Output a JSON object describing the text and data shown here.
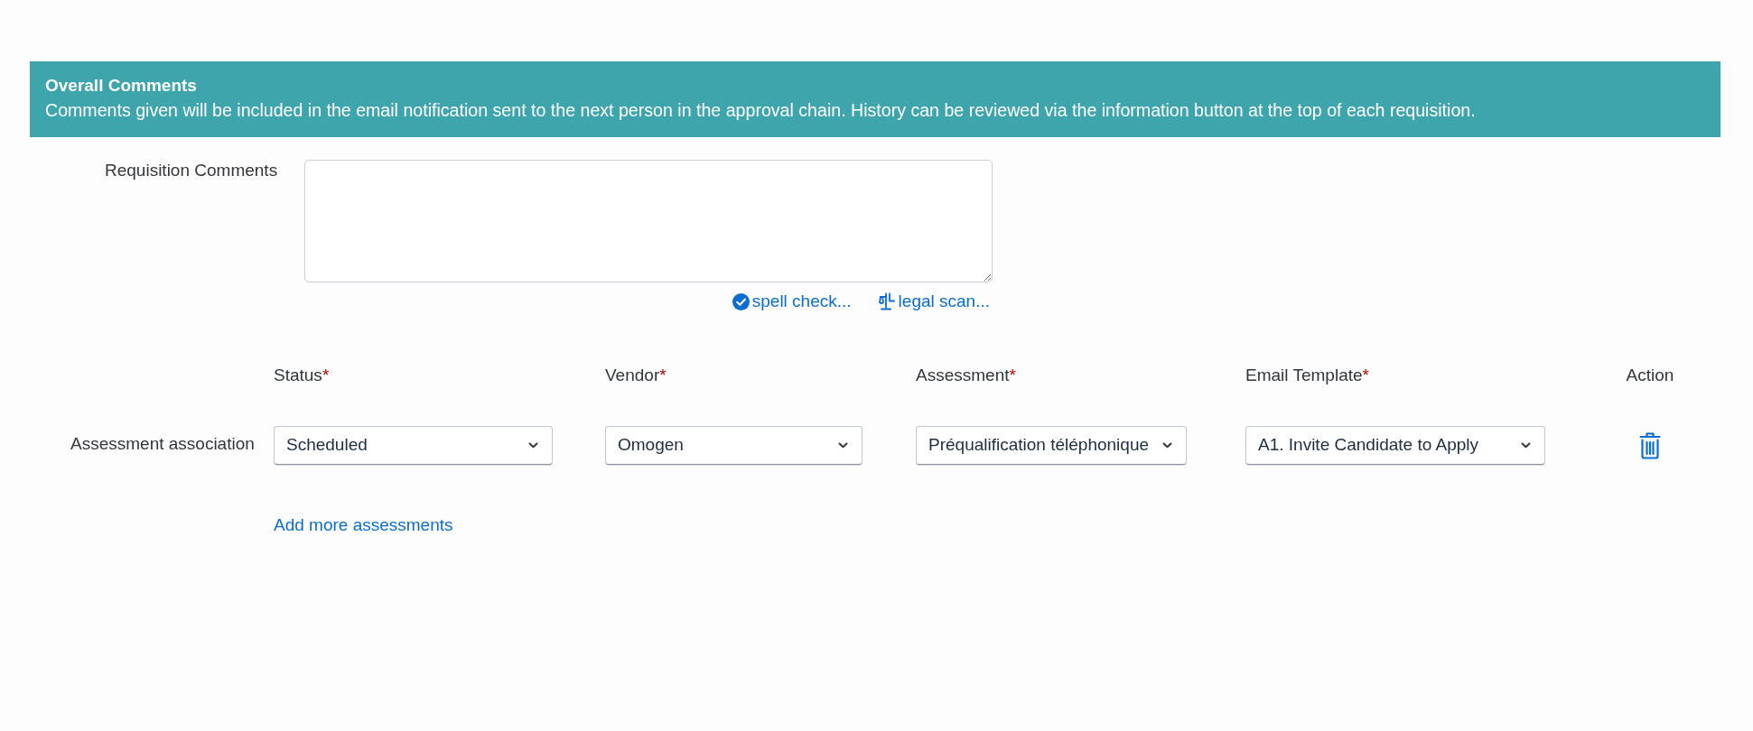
{
  "banner": {
    "title": "Overall Comments",
    "description": "Comments given will be included in the email notification sent to the next person in the approval chain. History can be reviewed via the information button at the top of each requisition."
  },
  "requisition_comments": {
    "label": "Requisition Comments",
    "links": [
      {
        "kind": "spell",
        "label": "spell check..."
      },
      {
        "kind": "legal",
        "label": "legal scan..."
      }
    ]
  },
  "assessments": {
    "columns": [
      {
        "kind": "field",
        "label": "Status",
        "required_mark": "*"
      },
      {
        "kind": "field",
        "label": "Vendor",
        "required_mark": "*"
      },
      {
        "kind": "field",
        "label": "Assessment",
        "required_mark": "*"
      },
      {
        "kind": "field",
        "label": "Email Template",
        "required_mark": "*"
      },
      {
        "kind": "action",
        "label": "Action"
      }
    ],
    "rows": [
      {
        "label": "Assessment association",
        "values": [
          "Scheduled",
          "Omogen",
          "Préqualification téléphonique",
          "A1. Invite Candidate to Apply"
        ],
        "actions": [
          {
            "kind": "delete"
          }
        ]
      }
    ],
    "add_link": "Add more assessments"
  }
}
